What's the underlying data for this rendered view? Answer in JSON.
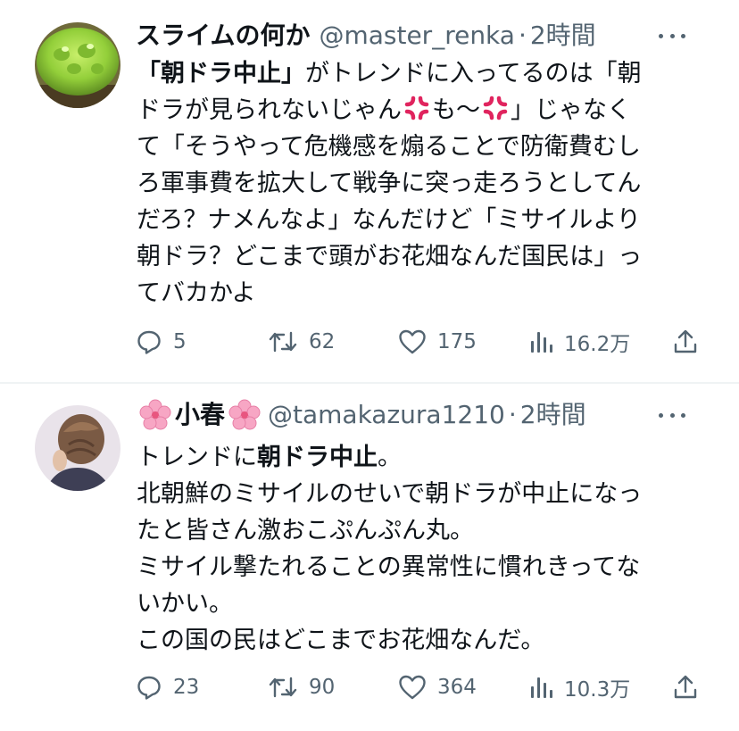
{
  "tweets": [
    {
      "display_name": "スライムの何か",
      "handle": "@master_renka",
      "separator": "·",
      "time": "2時間",
      "avatar_icon": "green-slime-avatar",
      "body": {
        "l1_bold": "「朝ドラ中止」",
        "l1_rest": "がトレンドに入ってるのは「朝",
        "l2_a": "ドラが見られないじゃん",
        "l2_b": "も〜",
        "l2_c": "」じゃなく",
        "l3": "て「そうやって危機感を煽ることで防衛費むし",
        "l4": "ろ軍事費を拡大して戦争に突っ走ろうとしてん",
        "l5": "だろ？ナメんなよ」なんだけど「ミサイルより",
        "l6": "朝ドラ？どこまで頭がお花畑なんだ国民は」っ",
        "l7": "てバカかよ"
      },
      "actions": {
        "replies": "5",
        "retweets": "62",
        "likes": "175",
        "views": "16.2万"
      }
    },
    {
      "display_name": "小春",
      "handle": "@tamakazura1210",
      "separator": "·",
      "time": "2時間",
      "avatar_icon": "hair-bun-photo-avatar",
      "body": {
        "l1_a": "トレンドに",
        "l1_bold": "朝ドラ中止",
        "l1_c": "。",
        "l2": "北朝鮮のミサイルのせいで朝ドラが中止になっ",
        "l3": "たと皆さん激おこぷんぷん丸。",
        "l4": "ミサイル撃たれることの異常性に慣れきってな",
        "l5": "いかい。",
        "l6": "この国の民はどこまでお花畑なんだ。"
      },
      "actions": {
        "replies": "23",
        "retweets": "90",
        "likes": "364",
        "views": "10.3万"
      }
    }
  ],
  "colors": {
    "text": "#0f1419",
    "secondary": "#536471",
    "divider": "#eff3f4",
    "anger_emoji": "#e0245e",
    "flower_emoji": "#f7a6c4"
  }
}
